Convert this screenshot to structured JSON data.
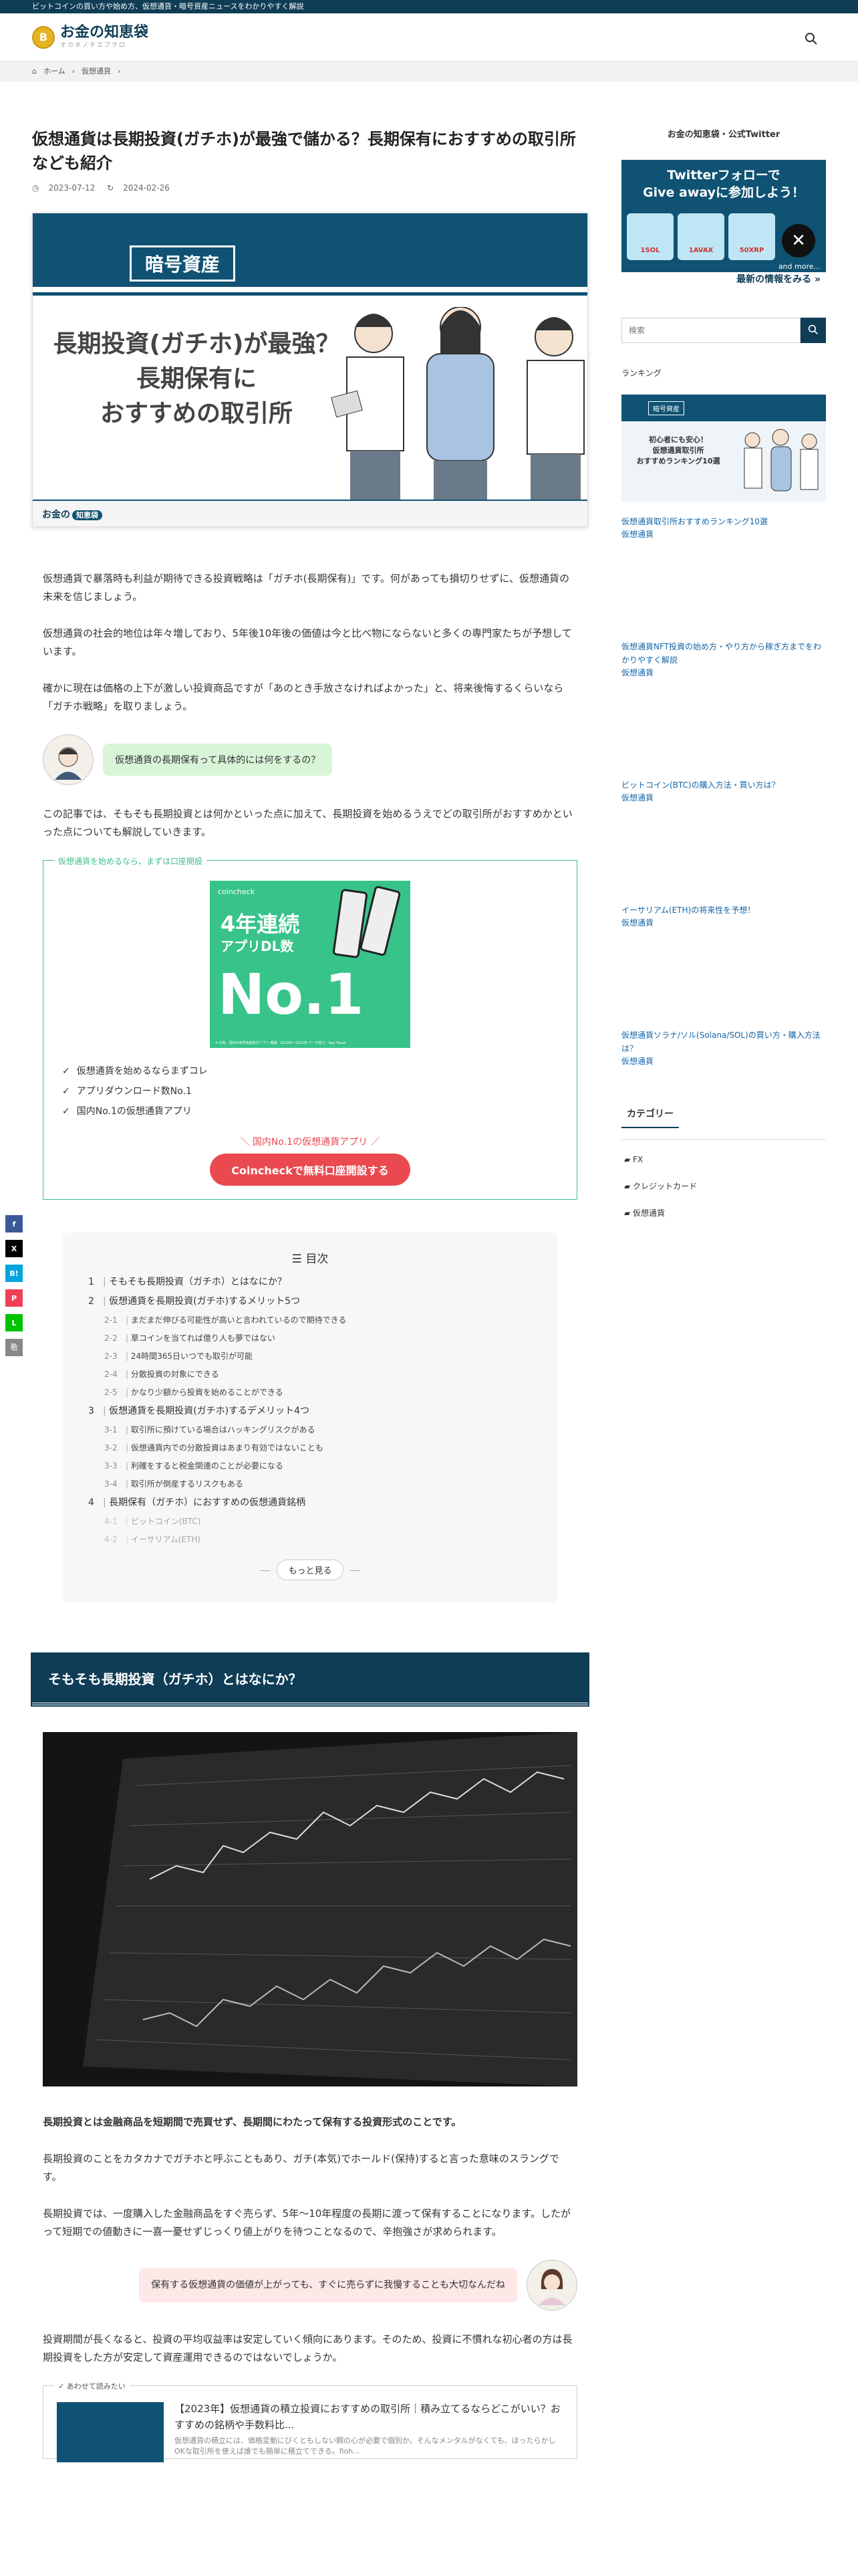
{
  "topbar": {
    "text": "ビットコインの買い方や始め方、仮想通貨・暗号資産ニュースをわかりやすく解説"
  },
  "header": {
    "logo_mark": "B",
    "logo_title": "お金の知恵袋",
    "logo_sub": "オカネノチエブクロ"
  },
  "breadcrumb": {
    "home": "ホーム",
    "current": "仮想通貨"
  },
  "article": {
    "title": "仮想通貨は長期投資(ガチホ)が最強で儲かる？長期保有におすすめの取引所なども紹介",
    "published": "2023-07-12",
    "updated": "2024-02-26",
    "eyecatch": {
      "tag": "暗号資産",
      "title_line1": "長期投資(ガチホ)が最強？",
      "title_line2": "長期保有に",
      "title_line3": "おすすめの取引所",
      "brand": "お金の",
      "brand_badge": "知恵袋"
    },
    "intro_p1": "仮想通貨で暴落時も利益が期待できる投資戦略は「ガチホ(長期保有)」です。何があっても損切りせずに、仮想通貨の未来を信じましょう。",
    "intro_p2": "仮想通貨の社会的地位は年々増しており、5年後10年後の価値は今と比べ物にならないと多くの専門家たちが予想しています。",
    "intro_p3": "確かに現在は価格の上下が激しい投資商品ですが「あのとき手放さなければよかった」と、将来後悔するくらいなら「ガチホ戦略」を取りましょう。",
    "question": "仮想通貨の長期保有って具体的には何をするの？",
    "intro_p4": "この記事では、そもそも長期投資とは何かといった点に加えて、長期投資を始めるうえでどの取引所がおすすめかといった点についても解説していきます。",
    "ad": {
      "label": "仮想通貨を始めるなら、まずは口座開設",
      "brand": "coincheck",
      "headline1": "4年連続",
      "headline2": "アプリDL数",
      "headline3": "No.1",
      "note": "※ 対象：国内の暗号資産取引アプリ 期間：2019年〜2022年 データ協力：App Tweak",
      "points": [
        "仮想通貨を始めるならまずコレ",
        "アプリダウンロード数No.1",
        "国内No.1の仮想通貨アプリ"
      ],
      "sub": "＼ 国内No.1の仮想通貨アプリ ／",
      "button": "Coincheckで無料口座開設する"
    },
    "toc": {
      "title": "目次",
      "items": [
        {
          "num": "1",
          "label": "そもそも長期投資（ガチホ）とはなにか？",
          "level": 2
        },
        {
          "num": "2",
          "label": "仮想通貨を長期投資(ガチホ)するメリット5つ",
          "level": 2
        },
        {
          "num": "2-1",
          "label": "まだまだ伸びる可能性が高いと言われているので期待できる",
          "level": 3
        },
        {
          "num": "2-2",
          "label": "草コインを当てれば億り人も夢ではない",
          "level": 3
        },
        {
          "num": "2-3",
          "label": "24時間365日いつでも取引が可能",
          "level": 3
        },
        {
          "num": "2-4",
          "label": "分散投資の対象にできる",
          "level": 3
        },
        {
          "num": "2-5",
          "label": "かなり少額から投資を始めることができる",
          "level": 3
        },
        {
          "num": "3",
          "label": "仮想通貨を長期投資(ガチホ)するデメリット4つ",
          "level": 2
        },
        {
          "num": "3-1",
          "label": "取引所に預けている場合はハッキングリスクがある",
          "level": 3
        },
        {
          "num": "3-2",
          "label": "仮想通貨内での分散投資はあまり有効ではないことも",
          "level": 3
        },
        {
          "num": "3-3",
          "label": "利確をすると税金関連のことが必要になる",
          "level": 3
        },
        {
          "num": "3-4",
          "label": "取引所が倒産するリスクもある",
          "level": 3
        },
        {
          "num": "4",
          "label": "長期保有（ガチホ）におすすめの仮想通貨銘柄",
          "level": 2
        },
        {
          "num": "4-1",
          "label": "ビットコイン(BTC)",
          "level": 3
        },
        {
          "num": "4-2",
          "label": "イーサリアム(ETH)",
          "level": 3
        }
      ],
      "more": "もっと見る"
    },
    "section1_title": "そもそも長期投資（ガチホ）とはなにか？",
    "s1_p1": "長期投資とは金融商品を短期間で売買せず、長期間にわたって保有する投資形式のことです。",
    "s1_p2": "長期投資のことをカタカナでガチホと呼ぶこともあり、ガチ(本気)でホールド(保持)すると言った意味のスラングです。",
    "s1_p3": "長期投資では、一度購入した金融商品をすぐ売らず、5年〜10年程度の長期に渡って保有することになります。したがって短期での値動きに一喜一憂せずじっくり値上がりを待つことなるので、辛抱強さが求められます。",
    "s1_bubble": "保有する仮想通貨の価値が上がっても、すぐに売らずに我慢することも大切なんだね",
    "s1_p4": "投資期間が長くなると、投資の平均収益率は安定していく傾向にあります。そのため、投資に不慣れな初心者の方は長期投資をした方が安定して資産運用できるのではないでしょうか。",
    "related": {
      "label": "あわせて読みたい",
      "title": "【2023年】仮想通貨の積立投資におすすめの取引所｜積み立てるならどこがいい？おすすめの銘柄や手数料比...",
      "desc": "仮想通貨の積立には、価格変動にびくともしない鋼の心が必要で個別か。そんなメンタルがなくても、ほったらかしOKな取引所を使えば誰でも簡単に積立てできる。fioh..."
    }
  },
  "sidebar": {
    "twitter_heading": "お金の知恵袋・公式Twitter",
    "tw_banner_line1": "Twitterフォローで",
    "tw_banner_line2": "Give awayに参加しよう！",
    "tw_banner_more": "最新の情報をみる »",
    "tw_coins": [
      "1SOL",
      "1AVAX",
      "50XRP"
    ],
    "tw_and_more": "and more...",
    "search_placeholder": "検索",
    "ranking_heading": "ランキング",
    "ranking_img": {
      "tag": "暗号資産",
      "line1": "初心者にも安心！",
      "line2": "仮想通貨取引所",
      "line3": "おすすめランキング10選"
    },
    "ranking_items": [
      {
        "title": "仮想通貨取引所おすすめランキング10選",
        "cat": "仮想通貨"
      },
      {
        "title": "仮想通貨NFT投資の始め方・やり方から稼ぎ方までをわかりやすく解説",
        "cat": "仮想通貨"
      },
      {
        "title": "ビットコイン(BTC)の購入方法・買い方は？",
        "cat": "仮想通貨"
      },
      {
        "title": "イーサリアム(ETH)の将来性を予想！",
        "cat": "仮想通貨"
      },
      {
        "title": "仮想通貨ソラナ/ソル(Solana/SOL)の買い方・購入方法は？",
        "cat": "仮想通貨"
      }
    ],
    "category_heading": "カテゴリー",
    "categories": [
      "FX",
      "クレジットカード",
      "仮想通貨"
    ]
  },
  "share": {
    "facebook": "f",
    "x": "X",
    "hatena": "B!",
    "pocket": "P",
    "line": "L",
    "copy": "⎘"
  },
  "colors": {
    "primary": "#0f3d56",
    "accent_green": "#3fbf8a",
    "accent_red": "#e9494f",
    "link": "#1565a6"
  }
}
